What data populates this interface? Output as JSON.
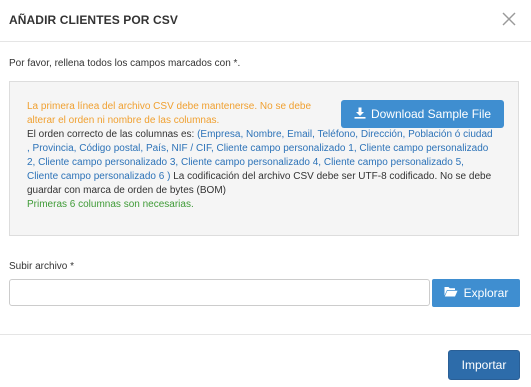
{
  "modal": {
    "title": "AÑADIR CLIENTES POR CSV",
    "close_icon": "close-icon"
  },
  "intro": "Por favor, rellena todos los campos marcados con *.",
  "info": {
    "warning": "La primera línea del archivo CSV debe mantenerse. No se debe alterar el orden ni nombre de las columnas.",
    "order_prefix": "El orden correcto de las columnas es: ",
    "columns": "(Empresa, Nombre, Email, Teléfono, Dirección, Población ó ciudad , Provincia, Código postal, País, NIF / CIF, Cliente campo personalizado 1, Cliente campo personalizado 2, Cliente campo personalizado 3, Cliente campo personalizado 4, Cliente campo personalizado 5, Cliente campo personalizado 6 )",
    "encoding": " La codificación del archivo CSV debe ser UTF-8 codificado. No se debe guardar con marca de orden de bytes (BOM)",
    "required": "Primeras 6 columnas son necesarias.",
    "download_label": "Download Sample File",
    "download_icon": "download-icon"
  },
  "upload": {
    "label": "Subir archivo *",
    "value": "",
    "browse_label": "Explorar",
    "browse_icon": "folder-open-icon"
  },
  "footer": {
    "import_label": "Importar"
  },
  "colors": {
    "primary": "#3f8ed0",
    "import": "#2d6caa",
    "warning": "#f0a030",
    "link": "#2d73b8",
    "success": "#3f9b37"
  }
}
